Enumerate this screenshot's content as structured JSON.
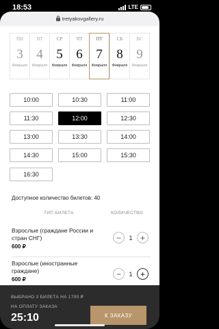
{
  "status": {
    "time": "18:53",
    "network": "LTE"
  },
  "browser": {
    "url": "tretyakovgallery.ru"
  },
  "days": [
    {
      "dow": "ПН",
      "num": "3",
      "month": "Февраля"
    },
    {
      "dow": "ВТ",
      "num": "4",
      "month": "Февраля"
    },
    {
      "dow": "СР",
      "num": "5",
      "month": "Февраля"
    },
    {
      "dow": "ЧТ",
      "num": "6",
      "month": "Февраля"
    },
    {
      "dow": "ПТ",
      "num": "7",
      "month": "Февраля"
    },
    {
      "dow": "СБ",
      "num": "8",
      "month": "Февраля"
    },
    {
      "dow": "ВС",
      "num": "9",
      "month": "Февраля"
    }
  ],
  "times": [
    "10:00",
    "10:30",
    "11:00",
    "11:30",
    "12:00",
    "12:30",
    "13:00",
    "13:30",
    "14:00",
    "14:30",
    "15:00",
    "15:30",
    "16:30"
  ],
  "selected_time": "12:00",
  "available": "Доступное количество билетов: 40",
  "table": {
    "type_header": "ТИП БИЛЕТА",
    "qty_header": "КОЛИЧЕСТВО"
  },
  "tickets": [
    {
      "name": "Взрослые (граждане России и стран СНГ)",
      "price": "600 ₽",
      "qty": "1"
    },
    {
      "name": "Взрослые (иностранные граждане)",
      "price": "600 ₽",
      "qty": "1"
    }
  ],
  "bottom": {
    "summary": "ВЫБРАНО 3 БИЛЕТА НА 1700 ₽",
    "pay_label": "НА ОПЛАТУ ЗАКАЗА",
    "timer": "25:10",
    "order_button": "К ЗАКАЗУ"
  },
  "colors": {
    "accent": "#b8956a",
    "bar": "#2c2c2c"
  }
}
